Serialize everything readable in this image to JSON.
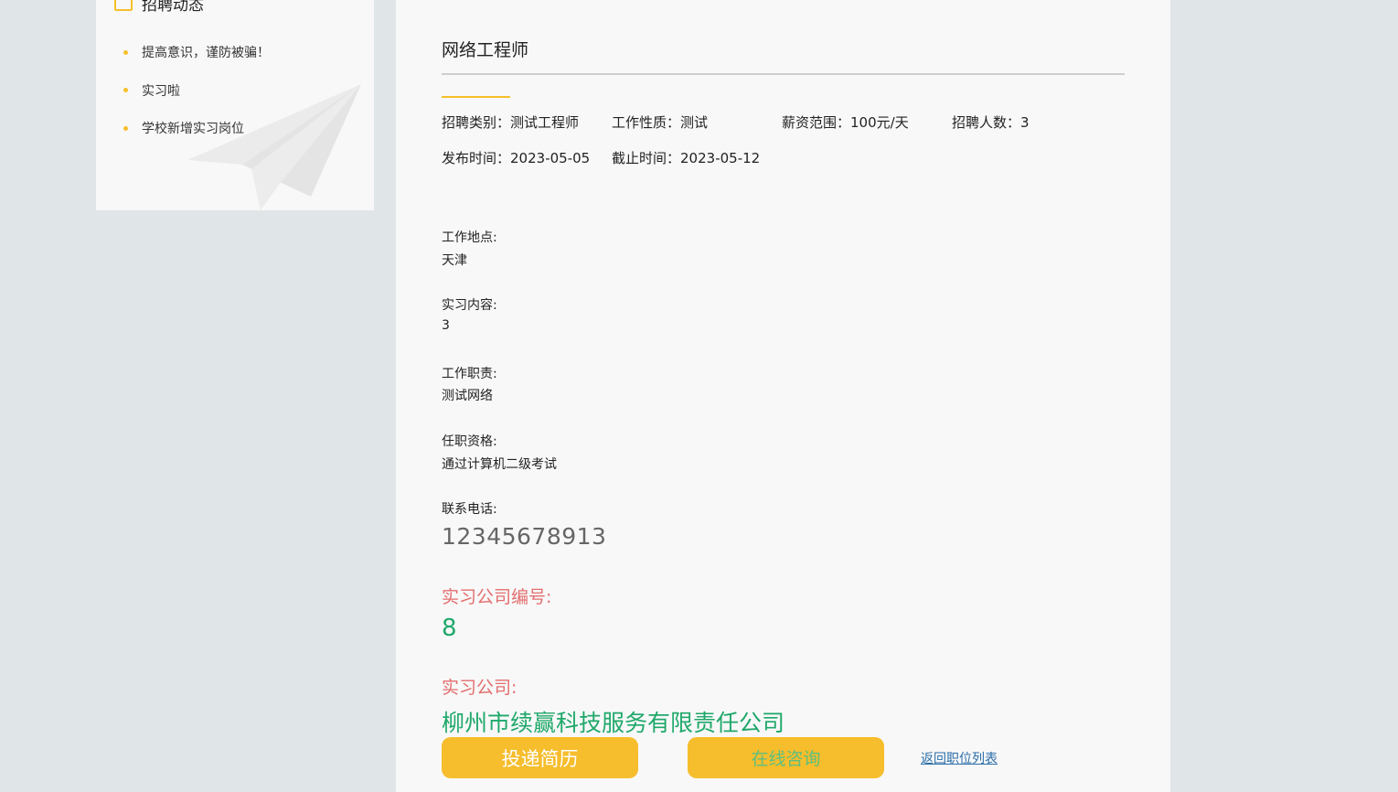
{
  "sidebar": {
    "title": "招聘动态",
    "news": [
      {
        "label": "提高意识，谨防被骗！"
      },
      {
        "label": "实习啦"
      },
      {
        "label": "学校新增实习岗位"
      }
    ]
  },
  "job": {
    "title": "网络工程师",
    "category_label": "招聘类别：",
    "category_value": "测试工程师",
    "nature_label": "工作性质：",
    "nature_value": "测试",
    "salary_label": "薪资范围：",
    "salary_value": "100元/天",
    "headcount_label": "招聘人数：",
    "headcount_value": "3",
    "publish_label": "发布时间：",
    "publish_value": "2023-05-05",
    "deadline_label": "截止时间：",
    "deadline_value": "2023-05-12"
  },
  "details": {
    "location_label": "工作地点:",
    "location_value": "天津",
    "content_label": "实习内容:",
    "content_value": "3",
    "duty_label": "工作职责:",
    "duty_value": "测试网络",
    "qualification_label": "任职资格:",
    "qualification_value": "通过计算机二级考试",
    "phone_label": "联系电话:",
    "phone_value": "12345678913"
  },
  "company": {
    "id_label": "实习公司编号:",
    "id_value": "8",
    "name_label": "实习公司:",
    "name_value": "柳州市续赢科技服务有限责任公司"
  },
  "actions": {
    "resume_button": "投递简历",
    "consult_button": "在线咨询",
    "back_link": "返回职位列表"
  },
  "colors": {
    "accent": "#f6bd2c",
    "red_label": "#e36e6e",
    "green_value": "#1fa86a",
    "link": "#2a6da8",
    "background": "#e0e5e8",
    "panel": "#f8f8f8"
  }
}
